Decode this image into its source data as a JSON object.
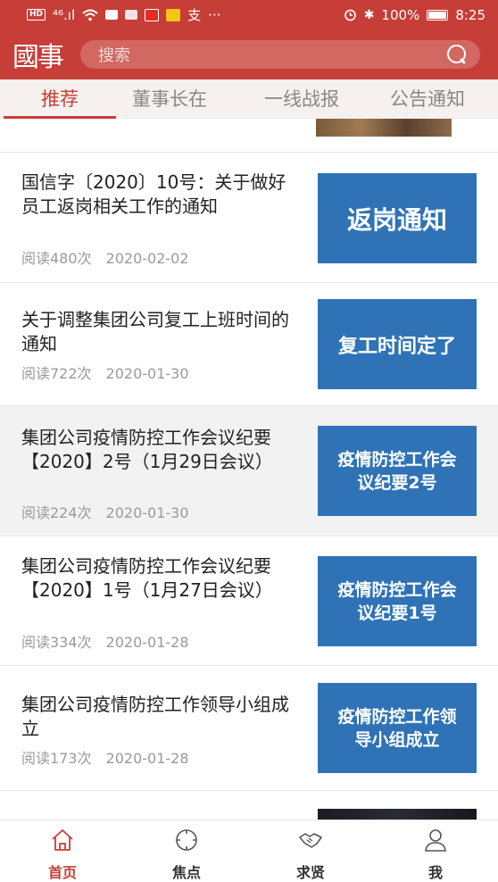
{
  "status_bar": {
    "signal": "⁴⁶.ıl",
    "battery": "100%",
    "time": "8:25",
    "more": "···"
  },
  "header": {
    "logo_text": "國事",
    "search_placeholder": "搜索"
  },
  "tabs": [
    "推荐",
    "董事长在",
    "一线战报",
    "公告通知"
  ],
  "articles": [
    {
      "title": "国信字〔2020〕10号：关于做好员工返岗相关工作的通知",
      "reads": "阅读480次",
      "date": "2020-02-02",
      "thumb_text": "返岗通知"
    },
    {
      "title": "关于调整集团公司复工上班时间的通知",
      "reads": "阅读722次",
      "date": "2020-01-30",
      "thumb_text": "复工时间定了"
    },
    {
      "title": "集团公司疫情防控工作会议纪要【2020】2号（1月29日会议）",
      "reads": "阅读224次",
      "date": "2020-01-30",
      "thumb_text": "疫情防控工作会议纪要2号"
    },
    {
      "title": "集团公司疫情防控工作会议纪要【2020】1号（1月27日会议）",
      "reads": "阅读334次",
      "date": "2020-01-28",
      "thumb_text": "疫情防控工作会议纪要1号"
    },
    {
      "title": "集团公司疫情防控工作领导小组成立",
      "reads": "阅读173次",
      "date": "2020-01-28",
      "thumb_text": "疫情防控工作领导小组成立"
    }
  ],
  "bottom_nav": [
    {
      "label": "首页",
      "icon": "home-icon"
    },
    {
      "label": "焦点",
      "icon": "focus-icon"
    },
    {
      "label": "求贤",
      "icon": "handshake-icon"
    },
    {
      "label": "我",
      "icon": "user-icon"
    }
  ],
  "colors": {
    "brand_red": "#c63e37",
    "thumb_blue": "#2f73b6"
  }
}
